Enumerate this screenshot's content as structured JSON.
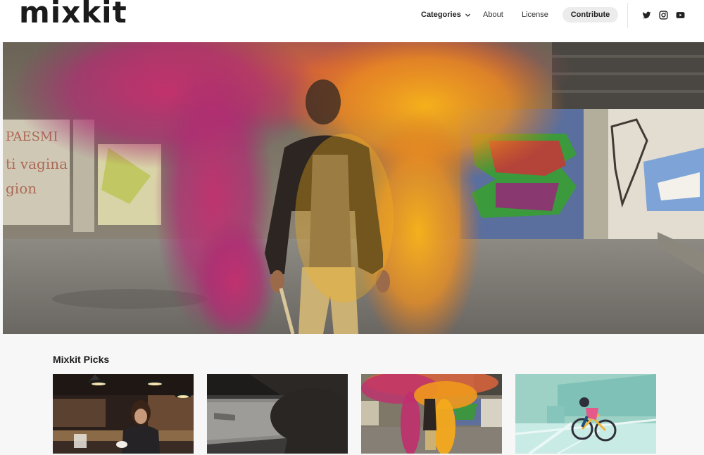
{
  "header": {
    "logo": "mixkit",
    "nav": {
      "categories": "Categories",
      "about": "About",
      "license": "License",
      "contribute": "Contribute"
    },
    "social_icons": [
      "twitter-icon",
      "instagram-icon",
      "youtube-icon"
    ]
  },
  "hero": {
    "description_icon": "hero-video"
  },
  "picks": {
    "title": "Mixkit Picks"
  },
  "colors": {
    "header_bg": "#ffffff",
    "page_bg": "#f7f7f7",
    "button_bg": "#ececec",
    "text": "#1c1c1c"
  }
}
